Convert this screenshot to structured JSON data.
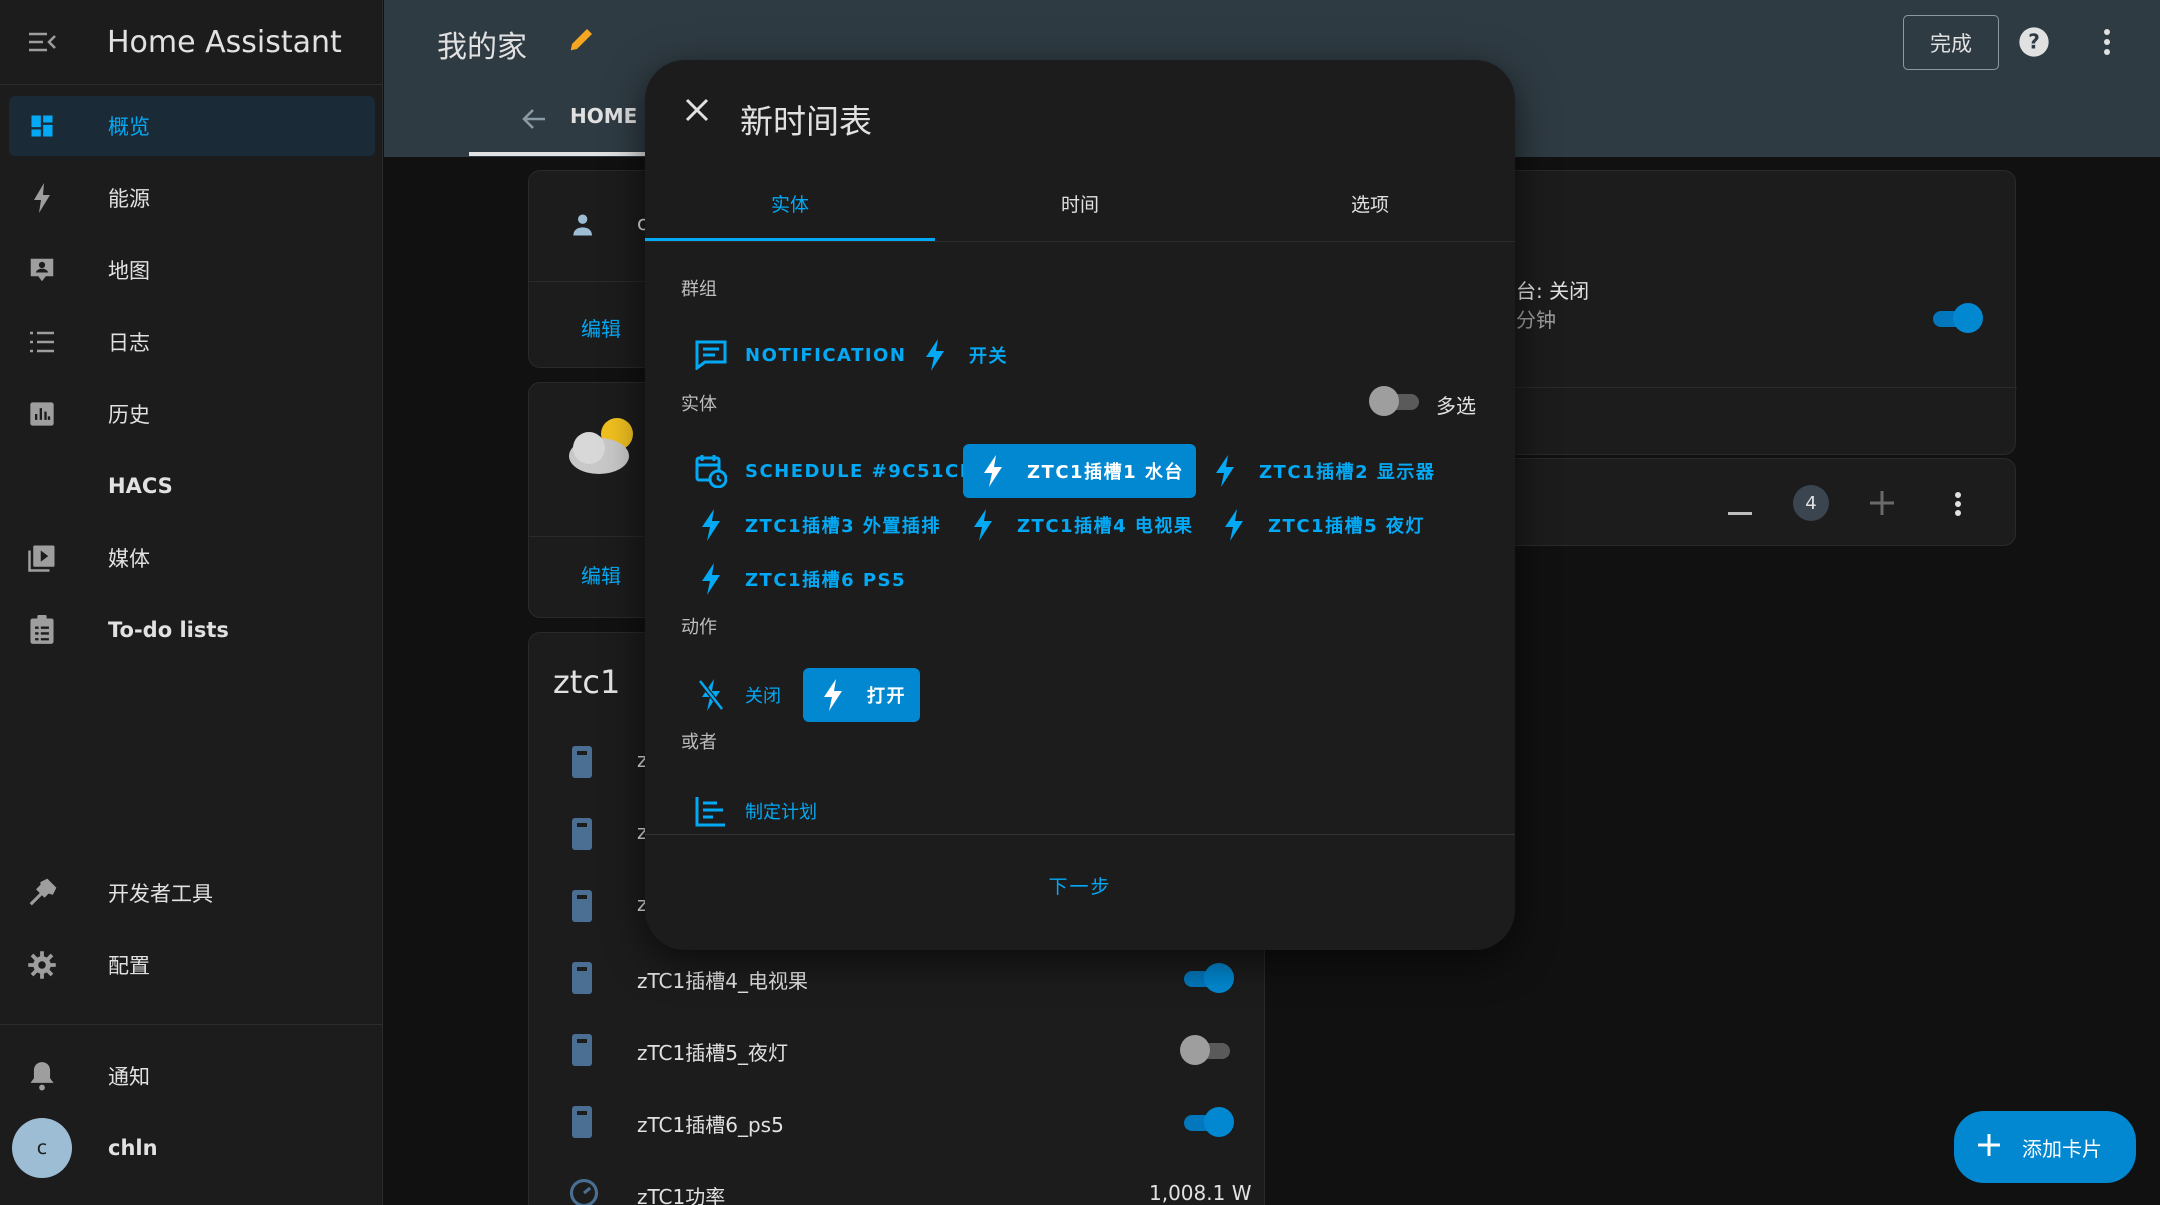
{
  "app": {
    "title": "Home Assistant"
  },
  "sidebar": {
    "items": [
      {
        "label": "概览",
        "icon": "dashboard-icon"
      },
      {
        "label": "能源",
        "icon": "lightning-icon"
      },
      {
        "label": "地图",
        "icon": "map-icon"
      },
      {
        "label": "日志",
        "icon": "list-icon"
      },
      {
        "label": "历史",
        "icon": "chart-icon"
      },
      {
        "label": "HACS",
        "icon": ""
      },
      {
        "label": "媒体",
        "icon": "media-icon"
      },
      {
        "label": "To-do lists",
        "icon": "clipboard-icon"
      }
    ],
    "dev_tools": "开发者工具",
    "settings": "配置",
    "notifications": "通知",
    "user_initial": "c",
    "user_name": "chln"
  },
  "header": {
    "page_title": "我的家",
    "done_label": "完成",
    "tab_home": "HOME"
  },
  "background": {
    "edit_label_1": "编辑",
    "edit_label_2": "编辑",
    "card_c": "c",
    "right_status": "台: 关闭",
    "right_sub": "分钟",
    "stepper_value": "4",
    "ztc1_title": "ztc1",
    "rows": [
      {
        "label": "z",
        "toggle": null
      },
      {
        "label": "z",
        "toggle": null
      },
      {
        "label": "z",
        "toggle": null
      },
      {
        "label": "zTC1插槽4_电视果",
        "toggle": "on"
      },
      {
        "label": "zTC1插槽5_夜灯",
        "toggle": "off"
      },
      {
        "label": "zTC1插槽6_ps5",
        "toggle": "on"
      }
    ],
    "power_label": "zTC1功率",
    "power_value": "1,008.1 W",
    "fab_label": "添加卡片"
  },
  "dialog": {
    "title": "新时间表",
    "tabs": [
      "实体",
      "时间",
      "选项"
    ],
    "group_label": "群组",
    "groups": [
      "NOTIFICATION",
      "开关"
    ],
    "entity_label": "实体",
    "multi_select": "多选",
    "entities": [
      "SCHEDULE #9C51CB",
      "ZTC1插槽1 水台",
      "ZTC1插槽2 显示器",
      "ZTC1插槽3 外置插排",
      "ZTC1插槽4 电视果",
      "ZTC1插槽5 夜灯",
      "ZTC1插槽6 PS5"
    ],
    "action_label": "动作",
    "actions": [
      "关闭",
      "打开"
    ],
    "or_label": "或者",
    "plan": "制定计划",
    "next": "下一步"
  },
  "colors": {
    "accent": "#03a9f4",
    "header": "#2f3b43",
    "sidebar": "#1c1c1c",
    "selected": "#0288d1"
  }
}
